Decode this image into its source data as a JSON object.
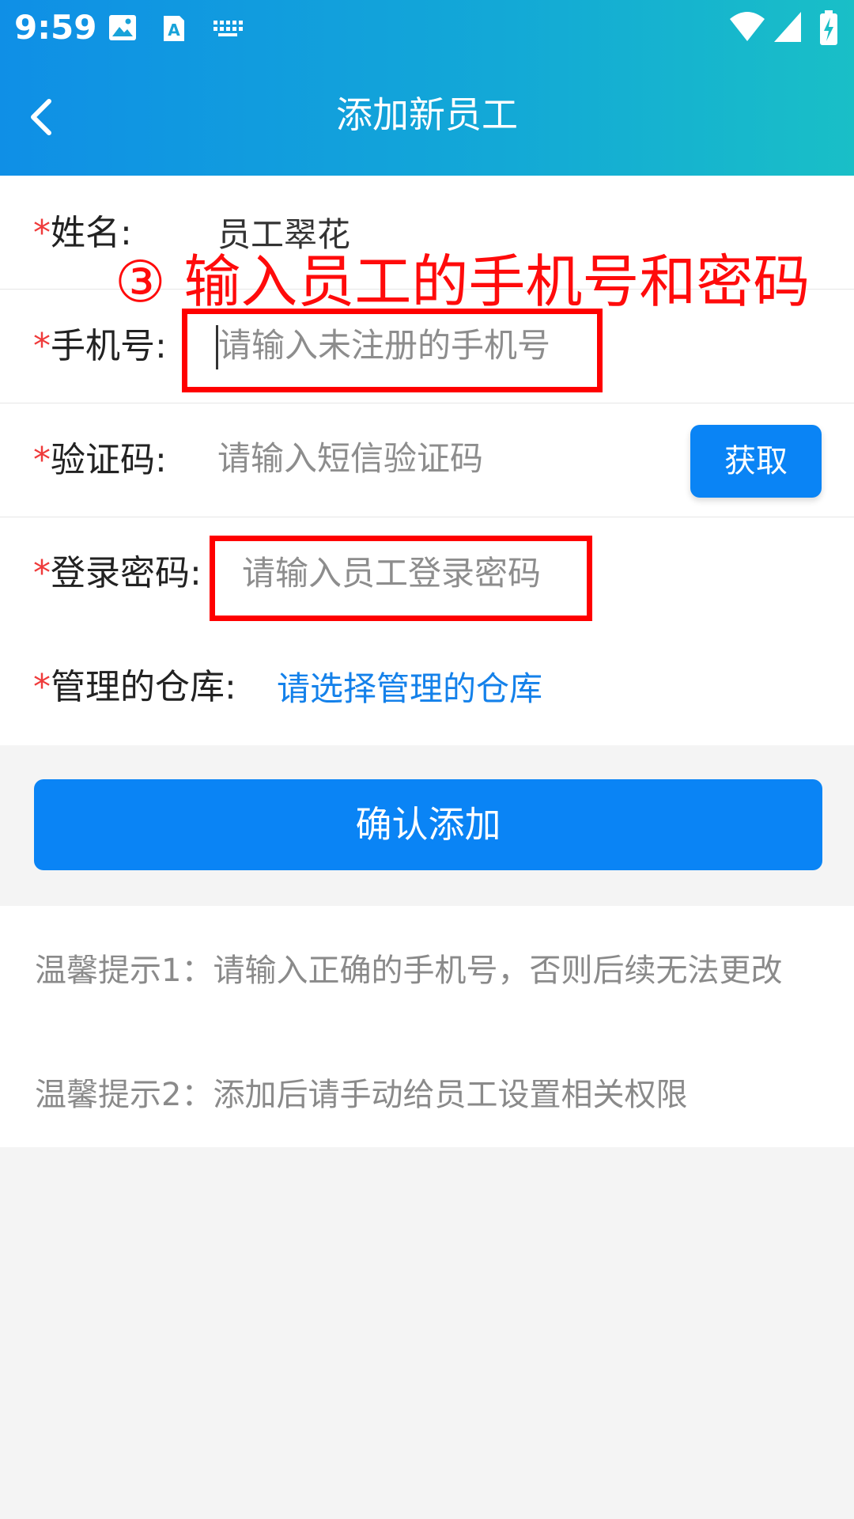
{
  "status_bar": {
    "time": "9:59",
    "icons": [
      "image-icon",
      "text-recognition-icon",
      "keyboard-icon",
      "wifi-icon",
      "cell-signal-icon",
      "battery-charging-icon"
    ]
  },
  "header": {
    "title": "添加新员工",
    "back_icon": "chevron-left-icon"
  },
  "form": {
    "name": {
      "star": "*",
      "label": "姓名:",
      "value": "员工翠花"
    },
    "phone": {
      "star": "*",
      "label": "手机号:",
      "placeholder": "请输入未注册的手机号"
    },
    "code": {
      "star": "*",
      "label": "验证码:",
      "placeholder": "请输入短信验证码",
      "button": "获取"
    },
    "password": {
      "star": "*",
      "label": "登录密码:",
      "placeholder": "请输入员工登录密码"
    },
    "warehouse": {
      "star": "*",
      "label": "管理的仓库:",
      "link": "请选择管理的仓库"
    }
  },
  "confirm_button": "确认添加",
  "tips": [
    "温馨提示1：请输入正确的手机号，否则后续无法更改",
    "温馨提示2：添加后请手动给员工设置相关权限"
  ],
  "annotation": {
    "text": "③ 输入员工的手机号和密码",
    "color": "#ff0000"
  },
  "colors": {
    "primary": "#0a84f5",
    "required_star": "#ef3b3b",
    "link": "#1481ea"
  }
}
